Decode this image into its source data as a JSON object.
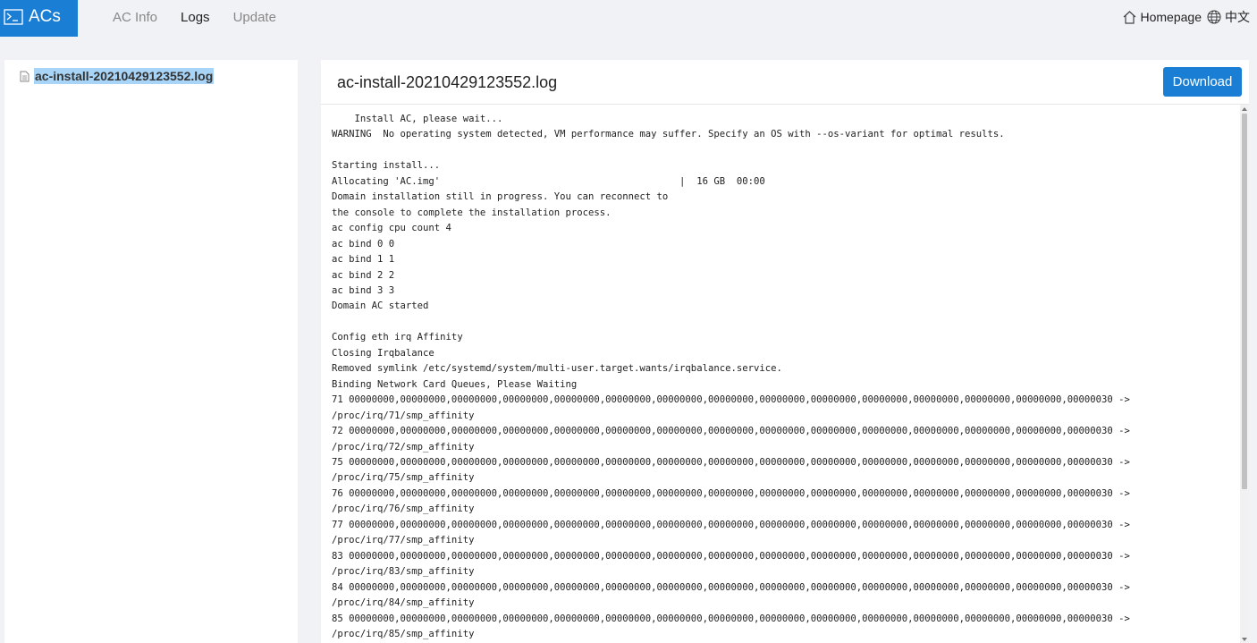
{
  "brand": {
    "title": "ACs",
    "color": "#1a7fd4"
  },
  "nav": {
    "items": [
      {
        "label": "AC Info",
        "active": false
      },
      {
        "label": "Logs",
        "active": true
      },
      {
        "label": "Update",
        "active": false
      }
    ]
  },
  "top_right": {
    "homepage": "Homepage",
    "language": "中文"
  },
  "sidebar": {
    "files": [
      {
        "label": "ac-install-20210429123552.log",
        "selected": true
      }
    ]
  },
  "panel": {
    "title": "ac-install-20210429123552.log",
    "download_label": "Download",
    "log_lines": [
      "    Install AC, please wait...",
      "WARNING  No operating system detected, VM performance may suffer. Specify an OS with --os-variant for optimal results.",
      "",
      "Starting install...",
      "Allocating 'AC.img'                                          |  16 GB  00:00",
      "Domain installation still in progress. You can reconnect to",
      "the console to complete the installation process.",
      "ac config cpu count 4",
      "ac bind 0 0",
      "ac bind 1 1",
      "ac bind 2 2",
      "ac bind 3 3",
      "Domain AC started",
      "",
      "Config eth irq Affinity",
      "Closing Irqbalance",
      "Removed symlink /etc/systemd/system/multi-user.target.wants/irqbalance.service.",
      "Binding Network Card Queues, Please Waiting",
      "71 00000000,00000000,00000000,00000000,00000000,00000000,00000000,00000000,00000000,00000000,00000000,00000000,00000000,00000000,00000030 ->",
      "/proc/irq/71/smp_affinity",
      "72 00000000,00000000,00000000,00000000,00000000,00000000,00000000,00000000,00000000,00000000,00000000,00000000,00000000,00000000,00000030 ->",
      "/proc/irq/72/smp_affinity",
      "75 00000000,00000000,00000000,00000000,00000000,00000000,00000000,00000000,00000000,00000000,00000000,00000000,00000000,00000000,00000030 ->",
      "/proc/irq/75/smp_affinity",
      "76 00000000,00000000,00000000,00000000,00000000,00000000,00000000,00000000,00000000,00000000,00000000,00000000,00000000,00000000,00000030 ->",
      "/proc/irq/76/smp_affinity",
      "77 00000000,00000000,00000000,00000000,00000000,00000000,00000000,00000000,00000000,00000000,00000000,00000000,00000000,00000000,00000030 ->",
      "/proc/irq/77/smp_affinity",
      "83 00000000,00000000,00000000,00000000,00000000,00000000,00000000,00000000,00000000,00000000,00000000,00000000,00000000,00000000,00000030 ->",
      "/proc/irq/83/smp_affinity",
      "84 00000000,00000000,00000000,00000000,00000000,00000000,00000000,00000000,00000000,00000000,00000000,00000000,00000000,00000000,00000030 ->",
      "/proc/irq/84/smp_affinity",
      "85 00000000,00000000,00000000,00000000,00000000,00000000,00000000,00000000,00000000,00000000,00000000,00000000,00000000,00000000,00000030 ->",
      "/proc/irq/85/smp_affinity"
    ]
  },
  "icons": {
    "brand": "terminal-icon",
    "homepage": "home-icon",
    "language": "globe-icon",
    "file": "file-icon"
  }
}
